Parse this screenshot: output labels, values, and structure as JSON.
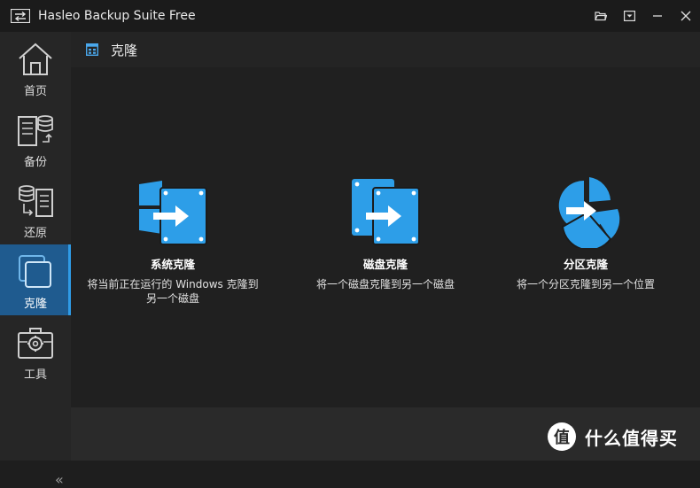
{
  "window": {
    "title": "Hasleo Backup Suite Free",
    "controls": [
      "folder-open-icon",
      "menu-dropdown-icon",
      "minimize-icon",
      "close-icon"
    ]
  },
  "sidebar": {
    "items": [
      {
        "label": "首页",
        "icon": "home-icon",
        "active": false
      },
      {
        "label": "备份",
        "icon": "backup-icon",
        "active": false
      },
      {
        "label": "还原",
        "icon": "restore-icon",
        "active": false
      },
      {
        "label": "克隆",
        "icon": "clone-icon",
        "active": true
      },
      {
        "label": "工具",
        "icon": "tools-icon",
        "active": false
      }
    ],
    "collapse_glyph": "«"
  },
  "panel": {
    "title": "克隆",
    "icon": "clone-grid-icon"
  },
  "options": [
    {
      "title": "系统克隆",
      "description": "将当前正在运行的 Windows 克隆到另一个磁盘",
      "icon": "system-clone-icon"
    },
    {
      "title": "磁盘克隆",
      "description": "将一个磁盘克隆到另一个磁盘",
      "icon": "disk-clone-icon"
    },
    {
      "title": "分区克隆",
      "description": "将一个分区克隆到另一个位置",
      "icon": "partition-clone-icon"
    }
  ],
  "watermark": {
    "glyph": "值",
    "text": "什么值得买"
  },
  "colors": {
    "accent": "#2f9be6",
    "active_bg": "#1f5b8f",
    "background": "#1e1e1e"
  }
}
